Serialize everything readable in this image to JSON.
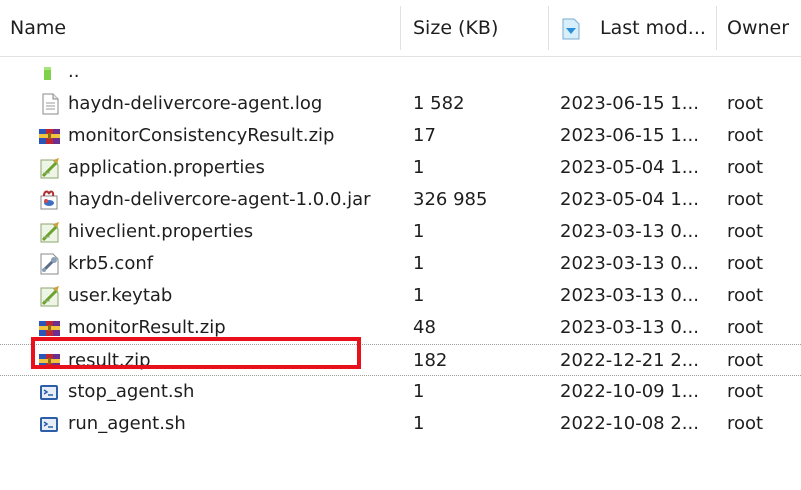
{
  "header": {
    "name": "Name",
    "size": "Size (KB)",
    "modified": "Last mod...",
    "owner": "Owner",
    "sort_icon": "sort-indicator-icon"
  },
  "files": [
    {
      "name": "..",
      "size": "",
      "date": "",
      "owner": "",
      "icon": "folder-up-icon"
    },
    {
      "name": "haydn-delivercore-agent.log",
      "size": "1 582",
      "date": "2023-06-15 1...",
      "owner": "root",
      "icon": "text-file-icon"
    },
    {
      "name": "monitorConsistencyResult.zip",
      "size": "17",
      "date": "2023-06-15 1...",
      "owner": "root",
      "icon": "archive-icon"
    },
    {
      "name": "application.properties",
      "size": "1",
      "date": "2023-05-04 1...",
      "owner": "root",
      "icon": "properties-file-icon"
    },
    {
      "name": "haydn-delivercore-agent-1.0.0.jar",
      "size": "326 985",
      "date": "2023-05-04 1...",
      "owner": "root",
      "icon": "jar-file-icon"
    },
    {
      "name": "hiveclient.properties",
      "size": "1",
      "date": "2023-03-13 0...",
      "owner": "root",
      "icon": "properties-file-icon"
    },
    {
      "name": "krb5.conf",
      "size": "1",
      "date": "2023-03-13 0...",
      "owner": "root",
      "icon": "config-file-icon"
    },
    {
      "name": "user.keytab",
      "size": "1",
      "date": "2023-03-13 0...",
      "owner": "root",
      "icon": "properties-file-icon"
    },
    {
      "name": "monitorResult.zip",
      "size": "48",
      "date": "2023-03-13 0...",
      "owner": "root",
      "icon": "archive-icon"
    },
    {
      "name": "result.zip",
      "size": "182",
      "date": "2022-12-21 2...",
      "owner": "root",
      "icon": "archive-icon",
      "selected": true
    },
    {
      "name": "stop_agent.sh",
      "size": "1",
      "date": "2022-10-09 1...",
      "owner": "root",
      "icon": "shell-script-icon"
    },
    {
      "name": "run_agent.sh",
      "size": "1",
      "date": "2022-10-08 2...",
      "owner": "root",
      "icon": "shell-script-icon"
    }
  ],
  "highlight": {
    "color": "#e8101a",
    "target": "result.zip"
  }
}
